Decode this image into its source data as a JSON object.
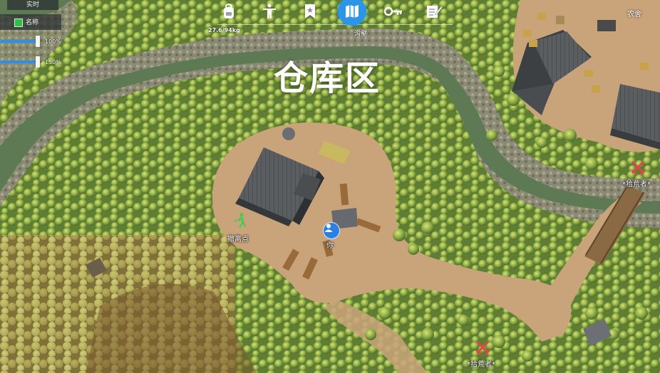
{
  "map": {
    "zone_name": "仓库区",
    "corner_area": "农舍",
    "player_label": "你",
    "extraction_label": "撤离点",
    "scavenger_label_1": "*拾荒者*",
    "scavenger_label_2": "*拾荒者*"
  },
  "panel": {
    "tab_label": "实时",
    "name_toggle_label": "名称",
    "name_toggle_checked": true,
    "slider_1_value": "100%",
    "slider_1_level": 1.0,
    "slider_2_value": "150%",
    "slider_2_level": 1.0
  },
  "nav": {
    "weight": "27.6/94kg",
    "active_tab_label": "沟壑",
    "tabs": [
      {
        "icon": "backpack-icon",
        "active": false
      },
      {
        "icon": "character-icon",
        "active": false
      },
      {
        "icon": "bookmark-star-icon",
        "active": false
      },
      {
        "icon": "map-icon",
        "active": true
      },
      {
        "icon": "key-icon",
        "active": false
      },
      {
        "icon": "notes-icon",
        "active": false
      }
    ]
  },
  "colors": {
    "accent": "#2d95e8",
    "enemy": "#e04848",
    "extraction": "#49c94f",
    "checkbox": "#2fbf48"
  }
}
